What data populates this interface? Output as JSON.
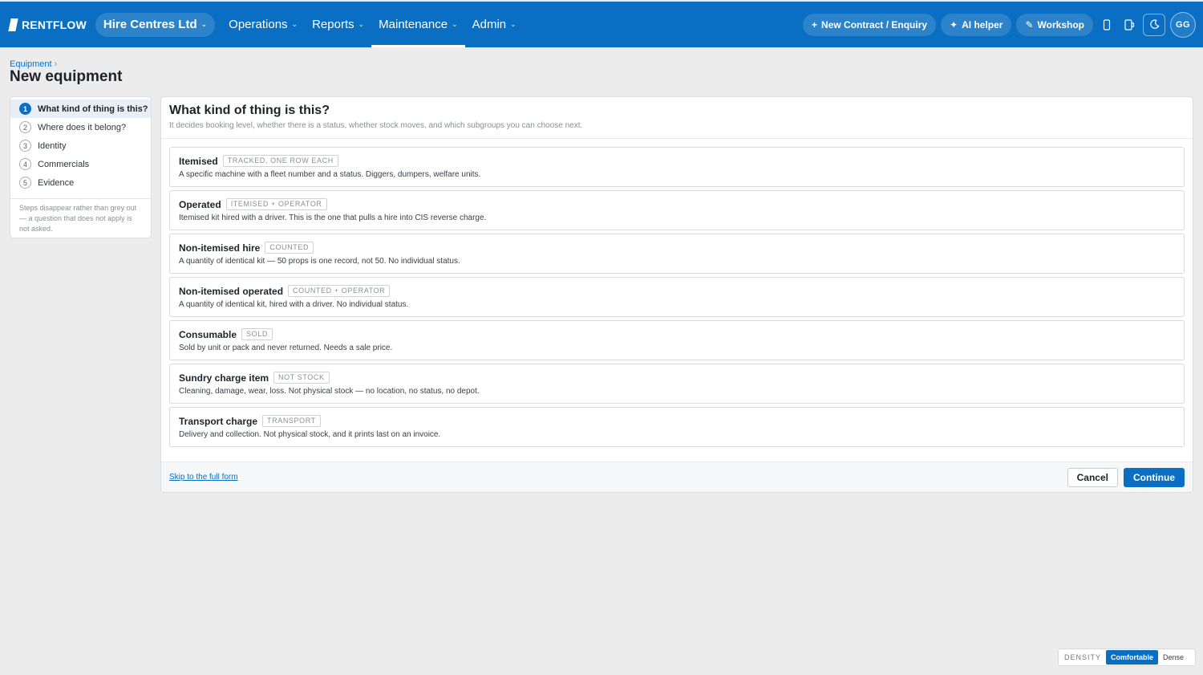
{
  "topbar": {
    "brand": "RENTFLOW",
    "tenant": "Hire Centres Ltd",
    "nav": [
      {
        "label": "Operations",
        "active": false
      },
      {
        "label": "Reports",
        "active": false
      },
      {
        "label": "Maintenance",
        "active": true
      },
      {
        "label": "Admin",
        "active": false
      }
    ],
    "actions": {
      "new_contract": "New Contract / Enquiry",
      "ai_helper": "AI helper",
      "workshop": "Workshop"
    },
    "avatar_initials": "GG"
  },
  "header": {
    "breadcrumb": "Equipment",
    "title": "New equipment"
  },
  "steps": {
    "items": [
      {
        "num": "1",
        "label": "What kind of thing is this?",
        "active": true
      },
      {
        "num": "2",
        "label": "Where does it belong?",
        "active": false
      },
      {
        "num": "3",
        "label": "Identity",
        "active": false
      },
      {
        "num": "4",
        "label": "Commercials",
        "active": false
      },
      {
        "num": "5",
        "label": "Evidence",
        "active": false
      }
    ],
    "note": "Steps disappear rather than grey out — a question that does not apply is not asked."
  },
  "panel": {
    "title": "What kind of thing is this?",
    "subtitle": "It decides booking level, whether there is a status, whether stock moves, and which subgroups you can choose next.",
    "options": [
      {
        "name": "Itemised",
        "tag": "TRACKED, ONE ROW EACH",
        "desc": "A specific machine with a fleet number and a status. Diggers, dumpers, welfare units."
      },
      {
        "name": "Operated",
        "tag": "ITEMISED + OPERATOR",
        "desc": "Itemised kit hired with a driver. This is the one that pulls a hire into CIS reverse charge."
      },
      {
        "name": "Non-itemised hire",
        "tag": "COUNTED",
        "desc": "A quantity of identical kit — 50 props is one record, not 50. No individual status."
      },
      {
        "name": "Non-itemised operated",
        "tag": "COUNTED + OPERATOR",
        "desc": "A quantity of identical kit, hired with a driver. No individual status."
      },
      {
        "name": "Consumable",
        "tag": "SOLD",
        "desc": "Sold by unit or pack and never returned. Needs a sale price."
      },
      {
        "name": "Sundry charge item",
        "tag": "NOT STOCK",
        "desc": "Cleaning, damage, wear, loss. Not physical stock — no location, no status, no depot."
      },
      {
        "name": "Transport charge",
        "tag": "TRANSPORT",
        "desc": "Delivery and collection. Not physical stock, and it prints last on an invoice."
      }
    ],
    "skip_link": "Skip to the full form",
    "cancel": "Cancel",
    "continue": "Continue"
  },
  "density": {
    "label": "DENSITY",
    "options": [
      {
        "label": "Comfortable",
        "selected": true
      },
      {
        "label": "Dense",
        "selected": false
      }
    ]
  },
  "colors": {
    "brand_blue": "#0a6fc2",
    "background": "#ececed"
  }
}
